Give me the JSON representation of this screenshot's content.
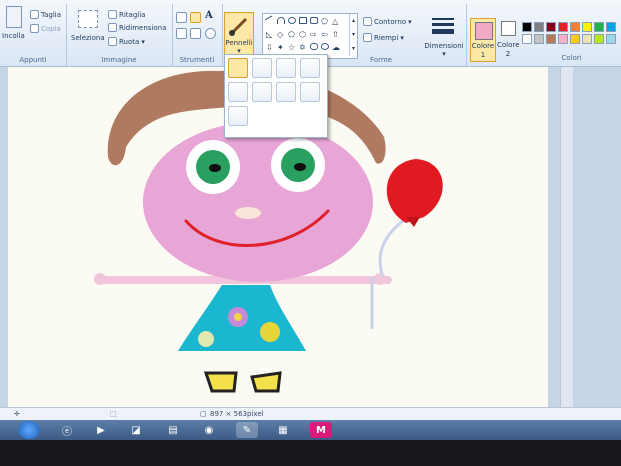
{
  "ribbon": {
    "clipboard": {
      "paste": "Incolla",
      "cut": "Taglia",
      "copy": "Copia",
      "label": "Appunti"
    },
    "image": {
      "select": "Seleziona",
      "crop": "Ritaglia",
      "resize": "Ridimensiona",
      "rotate": "Ruota",
      "label": "Immagine"
    },
    "tools": {
      "label": "Strumenti"
    },
    "brushes": {
      "label": "Pennelli"
    },
    "shapes": {
      "outline": "Contorno",
      "fill": "Riempi",
      "label": "Forme"
    },
    "size": {
      "label": "Dimensioni"
    },
    "color1": {
      "label_line1": "Colore",
      "label_line2": "1"
    },
    "color2": {
      "label_line1": "Colore",
      "label_line2": "2"
    },
    "colors": {
      "label": "Colori"
    }
  },
  "palette": [
    "#000000",
    "#7f7f7f",
    "#880015",
    "#ed1c24",
    "#ff7f27",
    "#fff200",
    "#22b14c",
    "#00a2e8",
    "#ffffff",
    "#c3c3c3",
    "#b97a57",
    "#ffaec9",
    "#ffc90e",
    "#efe4b0",
    "#b5e61d",
    "#99d9ea"
  ],
  "status": {
    "dimensions": "897 × 563pixel"
  },
  "taskbar": {
    "paint_badge": "M"
  }
}
